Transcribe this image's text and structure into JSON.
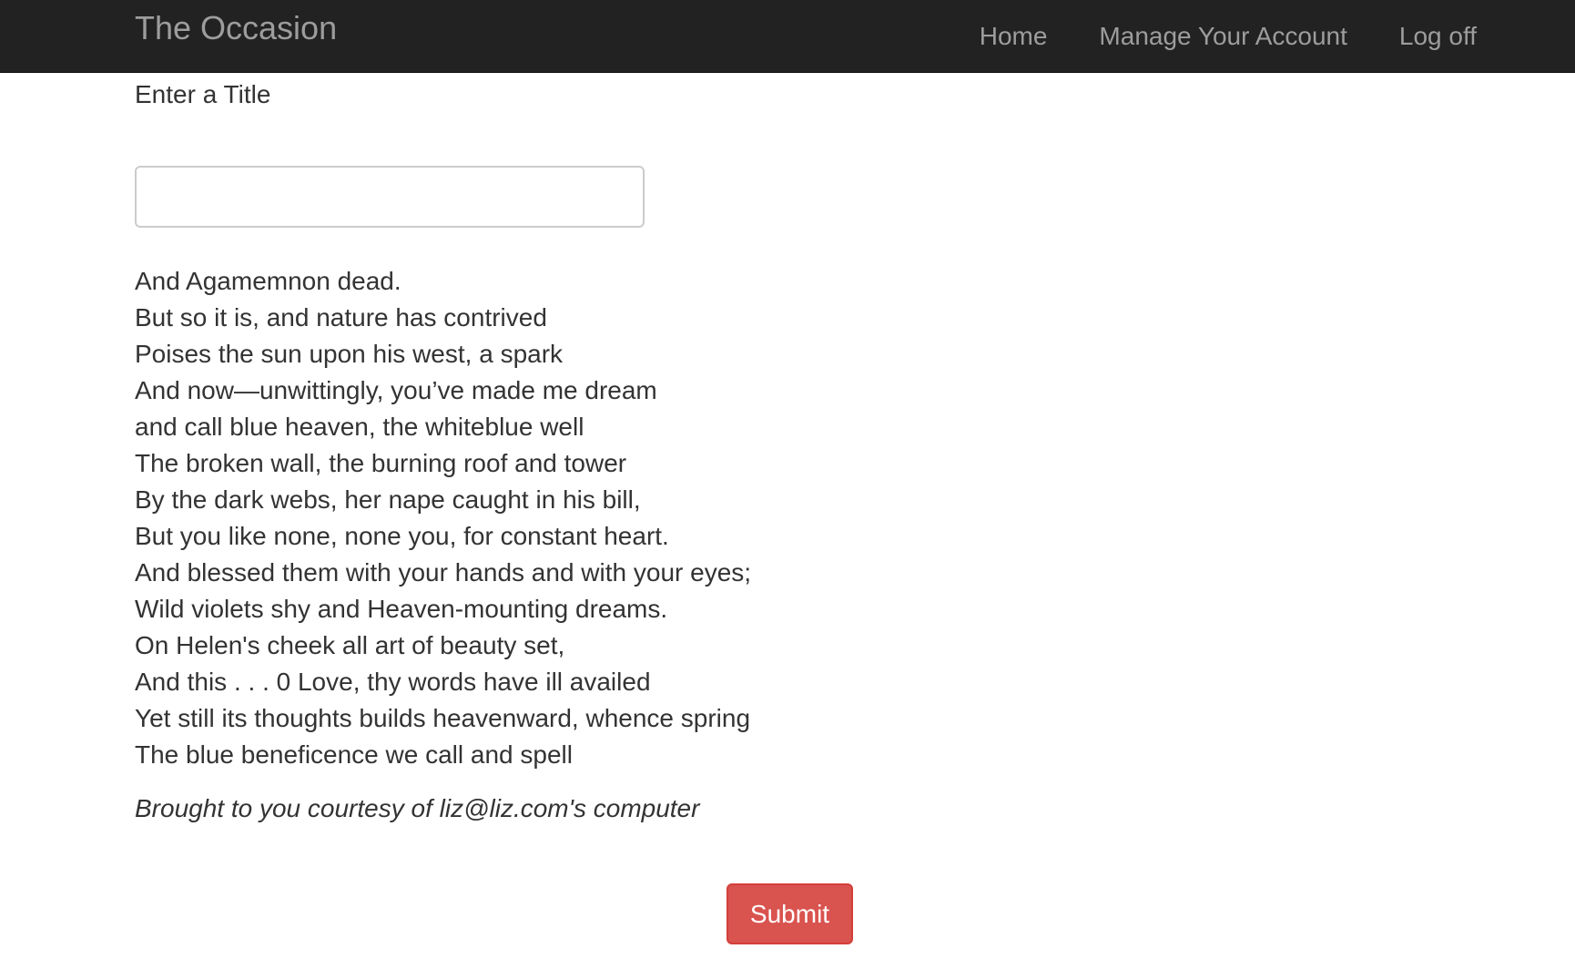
{
  "navbar": {
    "brand": "The Occasion",
    "links": [
      {
        "label": "Home"
      },
      {
        "label": "Manage Your Account"
      },
      {
        "label": "Log off"
      }
    ],
    "background_color": "#222222",
    "link_color": "#9d9d9d"
  },
  "form": {
    "title_label": "Enter a Title",
    "title_value": "",
    "title_placeholder": "",
    "submit_label": "Submit",
    "submit_color": "#d9534f"
  },
  "poem": {
    "lines": [
      "And Agamemnon dead.",
      "But so it is, and nature has contrived",
      "Poises the sun upon his west, a spark",
      "And now—unwittingly, you’ve made me dream",
      "and call blue heaven, the whiteblue well",
      "The broken wall, the burning roof and tower",
      "By the dark webs, her nape caught in his bill,",
      "But you like none, none you, for constant heart.",
      "And blessed them with your hands and with your eyes;",
      "Wild violets shy and Heaven-mounting dreams.",
      "On Helen's cheek all art of beauty set,",
      "And this . . . 0 Love, thy words have ill availed",
      "Yet still its thoughts builds heavenward, whence spring",
      "The blue beneficence we call and spell"
    ],
    "credit": "Brought to you courtesy of liz@liz.com's computer"
  }
}
